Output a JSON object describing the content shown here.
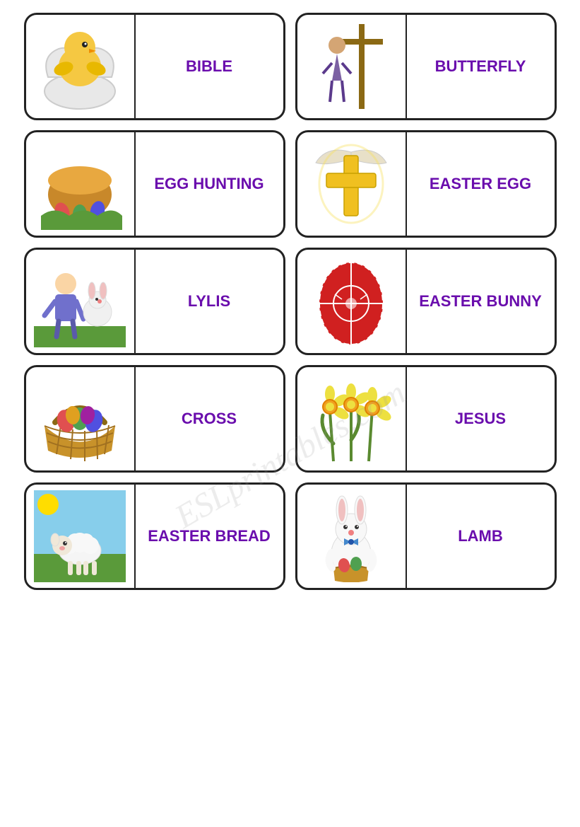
{
  "watermark": "ESLprintables.com",
  "rows": [
    {
      "cards": [
        {
          "id": "chick",
          "label": "BIBLE",
          "image_type": "chick"
        },
        {
          "id": "cross-carry",
          "label": "BUTTERFLY",
          "image_type": "cross-carry"
        }
      ]
    },
    {
      "cards": [
        {
          "id": "egg-basket",
          "label": "EGG\nHUNTING",
          "image_type": "egg-basket"
        },
        {
          "id": "gold-cross",
          "label": "EASTER\nEGG",
          "image_type": "gold-cross"
        }
      ]
    },
    {
      "cards": [
        {
          "id": "child-bunny",
          "label": "LYLIS",
          "image_type": "child-bunny"
        },
        {
          "id": "red-egg",
          "label": "EASTER\nBUNNY",
          "image_type": "red-egg"
        }
      ]
    },
    {
      "cards": [
        {
          "id": "basket",
          "label": "CROSS",
          "image_type": "basket"
        },
        {
          "id": "daffodils",
          "label": "JESUS",
          "image_type": "daffodils"
        }
      ]
    },
    {
      "cards": [
        {
          "id": "lamb",
          "label": "EASTER\nBREAD",
          "image_type": "lamb"
        },
        {
          "id": "bunny-basket",
          "label": "LAMB",
          "image_type": "bunny-basket"
        }
      ]
    }
  ]
}
